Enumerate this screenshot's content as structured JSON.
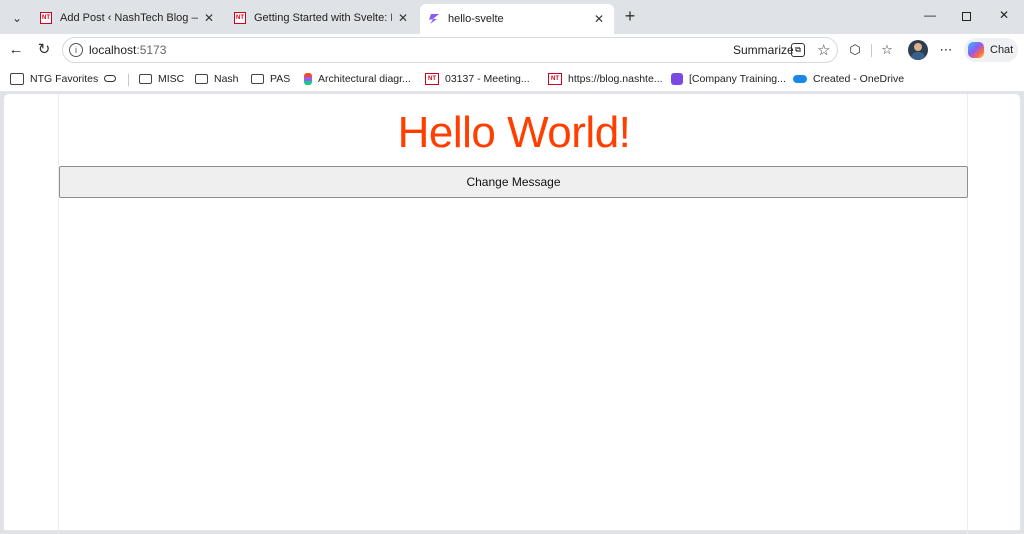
{
  "browser": {
    "tabs": [
      {
        "title": "Add Post ‹ NashTech Blog — WordPress",
        "favicon": "nashtech-favicon",
        "active": false
      },
      {
        "title": "Getting Started with Svelte: Build Y",
        "favicon": "nashtech-favicon",
        "active": false
      },
      {
        "title": "hello-svelte",
        "favicon": "svelte-favicon",
        "active": true
      }
    ],
    "favicon_text": "NT",
    "address": {
      "host": "localhost",
      "port": ":5173"
    },
    "summarize_label": "Summarize",
    "chat_label": "Chat",
    "bookmarks": [
      {
        "label": "NTG Favorites",
        "icon": "favorites-folder-icon"
      },
      {
        "label": "MISC",
        "icon": "folder-icon"
      },
      {
        "label": "Nash",
        "icon": "folder-icon"
      },
      {
        "label": "PAS",
        "icon": "folder-icon"
      },
      {
        "label": "Architectural diagr...",
        "icon": "figma-icon"
      },
      {
        "label": "03137 - Meeting...",
        "icon": "nashtech-icon"
      },
      {
        "label": "https://blog.nashte...",
        "icon": "nashtech-icon"
      },
      {
        "label": "[Company Training...",
        "icon": "video-icon"
      },
      {
        "label": "Created - OneDrive",
        "icon": "onedrive-icon"
      }
    ]
  },
  "page": {
    "heading": "Hello World!",
    "button_label": "Change Message"
  },
  "colors": {
    "accent": "#ff3e00"
  }
}
